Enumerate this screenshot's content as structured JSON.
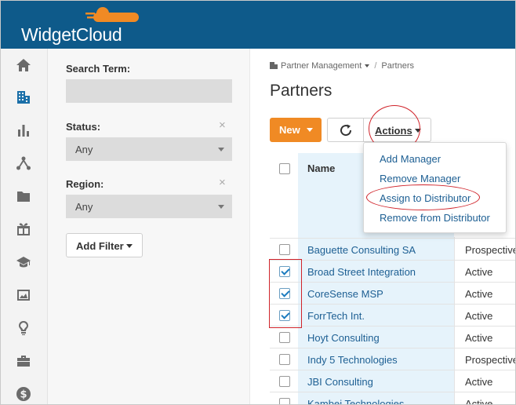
{
  "app": {
    "brand": "WidgetCloud"
  },
  "rail": {
    "items": [
      {
        "icon": "home-icon"
      },
      {
        "icon": "building-icon",
        "active": true
      },
      {
        "icon": "bar-chart-icon"
      },
      {
        "icon": "network-icon"
      },
      {
        "icon": "folder-icon"
      },
      {
        "icon": "gift-icon"
      },
      {
        "icon": "graduation-cap-icon"
      },
      {
        "icon": "image-icon"
      },
      {
        "icon": "lightbulb-icon"
      },
      {
        "icon": "briefcase-icon"
      },
      {
        "icon": "dollar-icon"
      }
    ]
  },
  "filters": {
    "search_label": "Search Term:",
    "search_value": "",
    "status_label": "Status:",
    "status_value": "Any",
    "region_label": "Region:",
    "region_value": "Any",
    "clear_glyph": "×",
    "add_filter_label": "Add Filter"
  },
  "breadcrumb": {
    "parent": "Partner Management",
    "separator": "/",
    "current": "Partners"
  },
  "page": {
    "title": "Partners"
  },
  "toolbar": {
    "new_label": "New",
    "actions_label": "Actions"
  },
  "actions_menu": {
    "items": [
      "Add Manager",
      "Remove Manager",
      "Assign to Distributor",
      "Remove from Distributor"
    ]
  },
  "table": {
    "columns": {
      "name": "Name"
    },
    "rows": [
      {
        "name": "Baguette Consulting SA",
        "status": "Prospective",
        "checked": false
      },
      {
        "name": "Broad Street Integration",
        "status": "Active",
        "checked": true
      },
      {
        "name": "CoreSense MSP",
        "status": "Active",
        "checked": true
      },
      {
        "name": "ForrTech Int.",
        "status": "Active",
        "checked": true
      },
      {
        "name": "Hoyt Consulting",
        "status": "Active",
        "checked": false
      },
      {
        "name": "Indy 5 Technologies",
        "status": "Prospective",
        "checked": false
      },
      {
        "name": "JBI Consulting",
        "status": "Active",
        "checked": false
      },
      {
        "name": "Kambei Technologies",
        "status": "Active",
        "checked": false
      }
    ]
  },
  "colors": {
    "header_bg": "#0e5a8a",
    "accent_orange": "#f08a24",
    "link_blue": "#1d5f93",
    "annotation_red": "#d0232a",
    "column_highlight": "#e6f3fb"
  }
}
